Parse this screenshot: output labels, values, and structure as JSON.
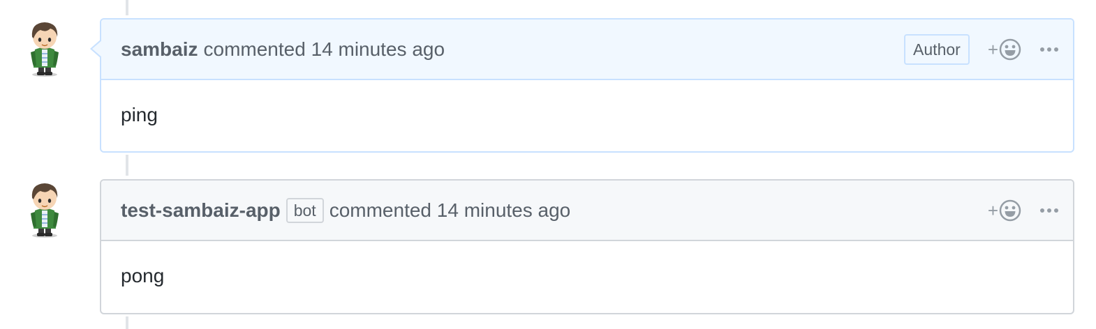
{
  "comments": [
    {
      "username": "sambaiz",
      "action_text": "commented 14 minutes ago",
      "author_label": "Author",
      "body": "ping",
      "avatar_icon": "user-avatar-icon"
    },
    {
      "username": "test-sambaiz-app",
      "bot_badge": "bot",
      "action_text": "commented 14 minutes ago",
      "body": "pong",
      "avatar_icon": "user-avatar-icon"
    }
  ],
  "icons": {
    "reaction": "smiley-plus-icon",
    "more": "kebab-horizontal-icon"
  },
  "colors": {
    "author_header_bg": "#f1f8ff",
    "author_border": "#c8e1ff",
    "header_bg": "#f6f8fa",
    "border": "#d1d5da",
    "text_muted": "#586069",
    "text_body": "#24292e"
  }
}
